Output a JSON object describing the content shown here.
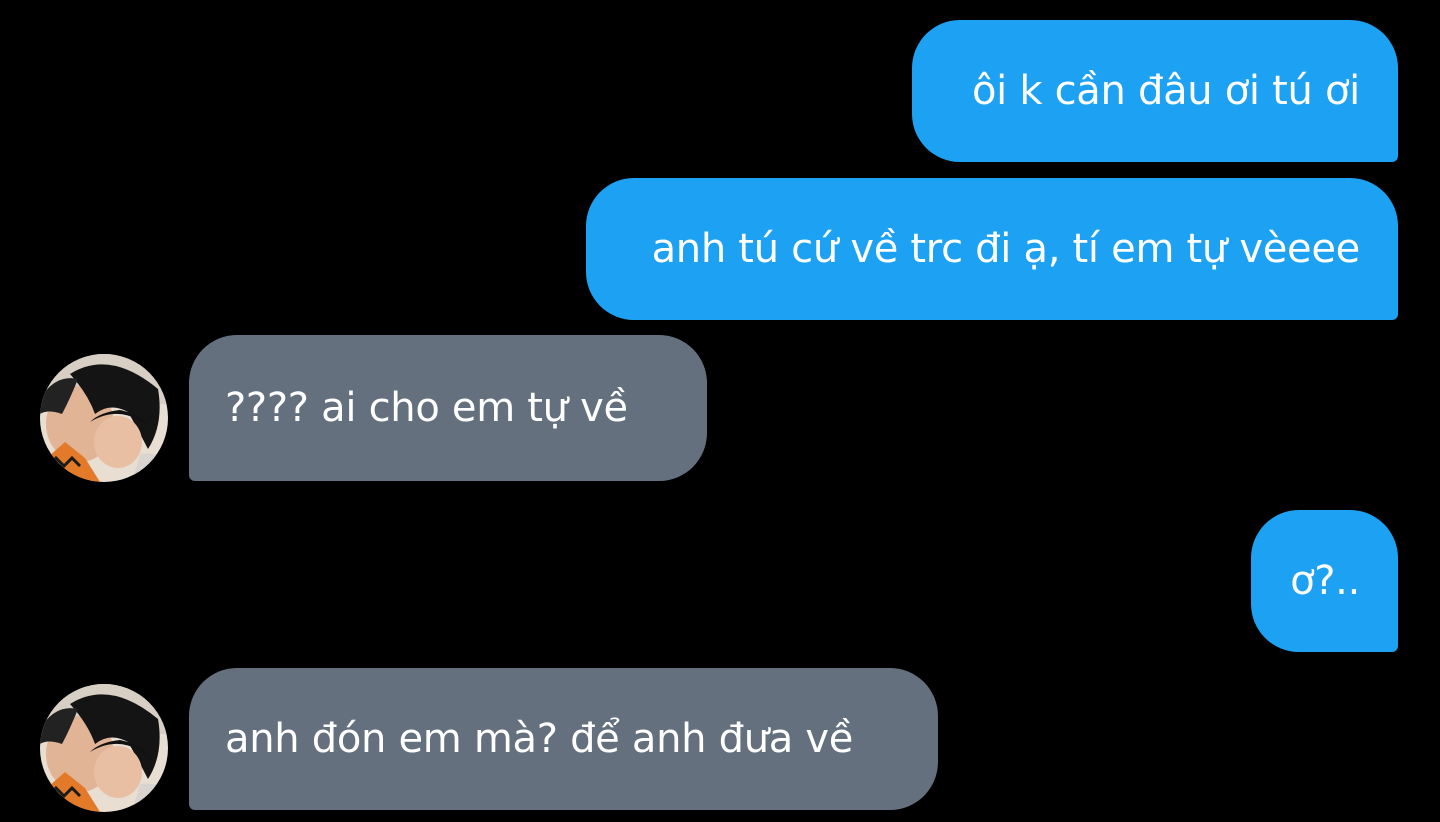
{
  "colors": {
    "background": "#000000",
    "sent_bubble": "#1da1f2",
    "received_bubble": "#64707d",
    "text": "#ffffff"
  },
  "messages": [
    {
      "direction": "sent",
      "text": "ôi k cần đâu ơi tú ơi"
    },
    {
      "direction": "sent",
      "text": "anh tú cứ về trc đi ạ, tí em tự vèeee"
    },
    {
      "direction": "received",
      "text": "???? ai cho em tự về"
    },
    {
      "direction": "sent",
      "text": "ơ?.."
    },
    {
      "direction": "received",
      "text": "anh đón em mà? để anh đưa về"
    }
  ],
  "contact": {
    "avatar_icon": "profile-photo-avatar"
  }
}
